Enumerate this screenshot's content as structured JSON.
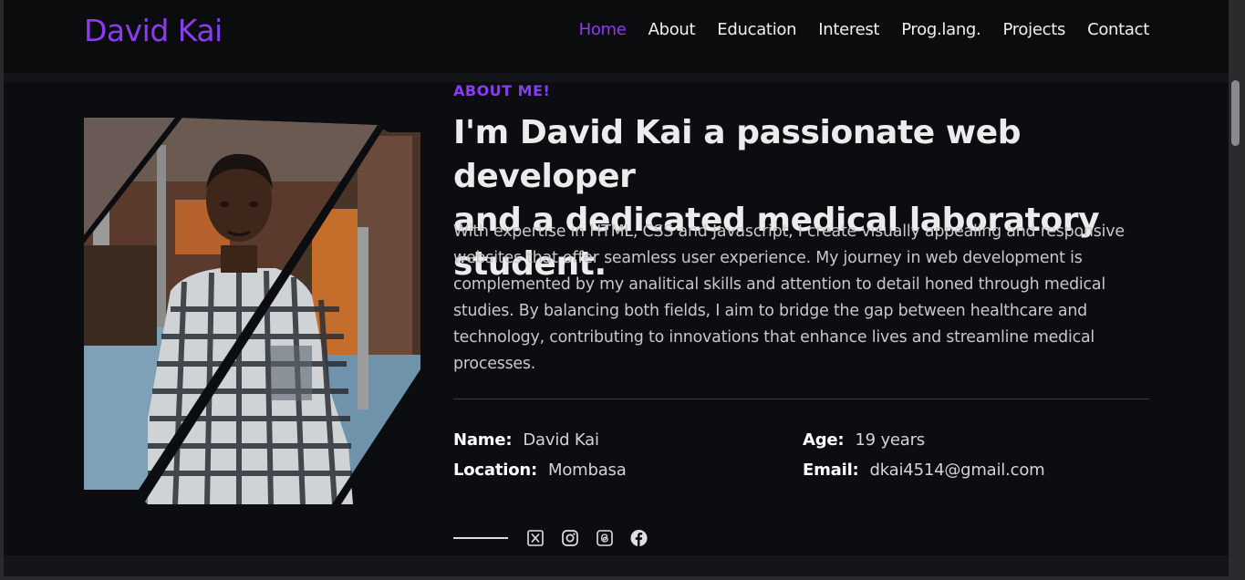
{
  "brand": {
    "logo": "David Kai",
    "accent": "#8a3cf0"
  },
  "nav": {
    "items": [
      {
        "label": "Home",
        "active": true
      },
      {
        "label": "About",
        "active": false
      },
      {
        "label": "Education",
        "active": false
      },
      {
        "label": "Interest",
        "active": false
      },
      {
        "label": "Prog.lang.",
        "active": false
      },
      {
        "label": "Projects",
        "active": false
      },
      {
        "label": "Contact",
        "active": false
      }
    ]
  },
  "about": {
    "eyebrow": "ABOUT ME!",
    "headline_line1": "I'm David Kai a passionate web developer",
    "headline_line2": "and a dedicated medical laboratory student.",
    "bio": "With expertise in HTML, CSS and Javascript, I create visually appealing and responsive websites that offer seamless user experience. My journey in web development is complemented by my analitical skills and attention to detail honed through medical studies. By balancing both fields, I aim to bridge the gap between healthcare and technology, contributing to innovations that enhance lives and streamline medical processes.",
    "info": {
      "name": {
        "label": "Name:",
        "value": "David Kai"
      },
      "location": {
        "label": "Location:",
        "value": "Mombasa"
      },
      "age": {
        "label": "Age:",
        "value": "19 years"
      },
      "email": {
        "label": "Email:",
        "value": "dkai4514@gmail.com"
      }
    }
  },
  "social": {
    "icons": [
      "x-icon",
      "instagram-icon",
      "threads-icon",
      "facebook-icon"
    ]
  }
}
